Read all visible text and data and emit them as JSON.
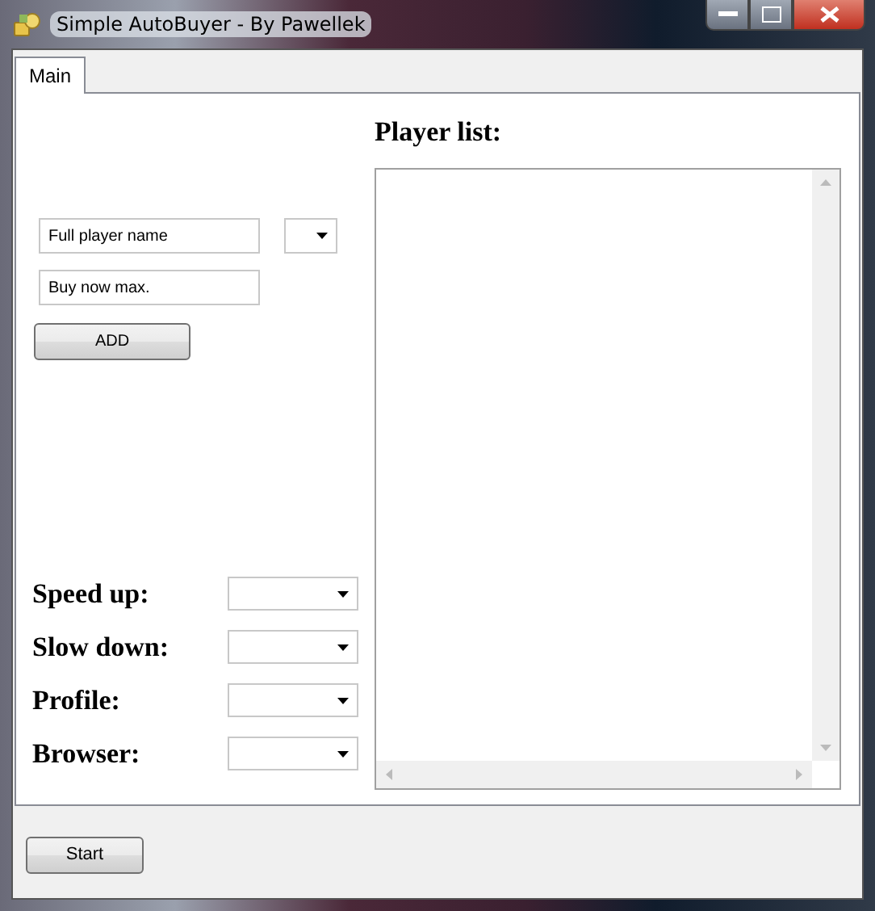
{
  "window": {
    "title": "Simple AutoBuyer - By Pawellek"
  },
  "tabs": [
    {
      "label": "Main",
      "selected": true
    }
  ],
  "player_form": {
    "name_field": {
      "value": "Full player name"
    },
    "price_field": {
      "value": "Buy now max."
    },
    "add_button": "ADD"
  },
  "settings": [
    {
      "label": "Speed up:"
    },
    {
      "label": "Slow down:"
    },
    {
      "label": "Profile:"
    },
    {
      "label": "Browser:"
    }
  ],
  "player_list": {
    "heading": "Player list:"
  },
  "buttons": [
    "Start"
  ]
}
